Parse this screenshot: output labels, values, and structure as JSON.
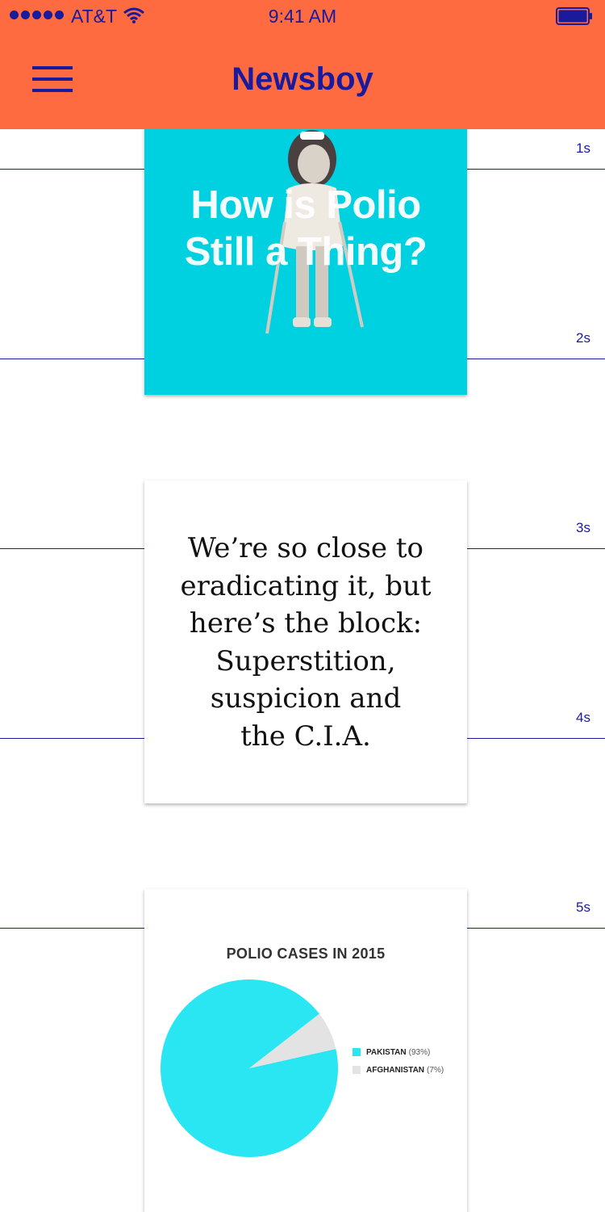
{
  "status_bar": {
    "carrier": "AT&T",
    "time": "9:41 AM"
  },
  "header": {
    "title": "Newsboy",
    "accent_color": "#ff6b40",
    "text_color": "#1a1a9c"
  },
  "timeline": {
    "ticks": [
      "1s",
      "2s",
      "3s",
      "4s",
      "5s"
    ]
  },
  "cards": [
    {
      "headline": "How is Polio Still a Thing?",
      "headline_lines": [
        "How is Polio",
        "Still a Thing?"
      ],
      "background": "#00d1e1",
      "image": "girl-on-crutches-photo"
    },
    {
      "quote_lines": [
        "We’re so close to",
        "eradicating it, but",
        "here’s the block:",
        "Superstition,",
        "suspicion and",
        "the C.I.A."
      ]
    },
    {
      "chart_title": "POLIO CASES IN 2015"
    }
  ],
  "chart_data": {
    "type": "pie",
    "title": "POLIO CASES IN 2015",
    "slices": [
      {
        "name": "PAKISTAN",
        "label": "(93%)",
        "value": 93,
        "color": "#2ae6f3"
      },
      {
        "name": "AFGHANISTAN",
        "label": "(7%)",
        "value": 7,
        "color": "#e3e3e3"
      }
    ]
  }
}
